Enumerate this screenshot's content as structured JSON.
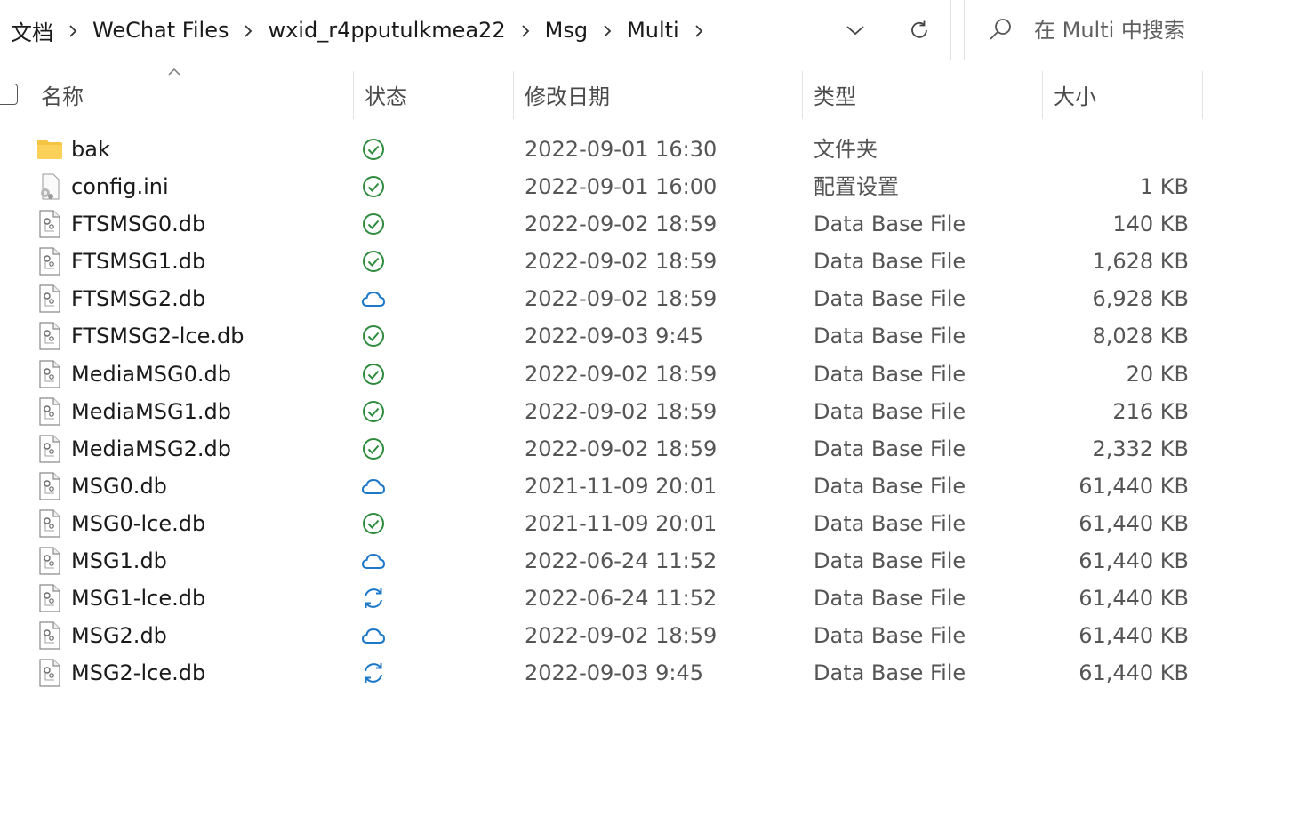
{
  "address": {
    "crumbs": [
      "文档",
      "WeChat Files",
      "wxid_r4pputulkmea22",
      "Msg",
      "Multi"
    ]
  },
  "search": {
    "placeholder": "在 Multi 中搜索"
  },
  "columns": {
    "name": "名称",
    "status": "状态",
    "modified": "修改日期",
    "type": "类型",
    "size": "大小"
  },
  "icons": {
    "folder": "folder-icon",
    "settings_file": "config-file-icon",
    "db_file": "db-file-icon",
    "synced": "green-check-icon",
    "cloud": "cloud-icon",
    "syncing": "sync-icon"
  },
  "colors": {
    "synced": "#2e8b3d",
    "cloud": "#1e78c8",
    "folder": "#f6c443"
  },
  "files": [
    {
      "name": "bak",
      "icon": "folder",
      "status": "synced",
      "date": "2022-09-01 16:30",
      "type": "文件夹",
      "size": ""
    },
    {
      "name": "config.ini",
      "icon": "settings",
      "status": "synced",
      "date": "2022-09-01 16:00",
      "type": "配置设置",
      "size": "1 KB"
    },
    {
      "name": "FTSMSG0.db",
      "icon": "db",
      "status": "synced",
      "date": "2022-09-02 18:59",
      "type": "Data Base File",
      "size": "140 KB"
    },
    {
      "name": "FTSMSG1.db",
      "icon": "db",
      "status": "synced",
      "date": "2022-09-02 18:59",
      "type": "Data Base File",
      "size": "1,628 KB"
    },
    {
      "name": "FTSMSG2.db",
      "icon": "db",
      "status": "cloud",
      "date": "2022-09-02 18:59",
      "type": "Data Base File",
      "size": "6,928 KB"
    },
    {
      "name": "FTSMSG2-lce.db",
      "icon": "db",
      "status": "synced",
      "date": "2022-09-03 9:45",
      "type": "Data Base File",
      "size": "8,028 KB"
    },
    {
      "name": "MediaMSG0.db",
      "icon": "db",
      "status": "synced",
      "date": "2022-09-02 18:59",
      "type": "Data Base File",
      "size": "20 KB"
    },
    {
      "name": "MediaMSG1.db",
      "icon": "db",
      "status": "synced",
      "date": "2022-09-02 18:59",
      "type": "Data Base File",
      "size": "216 KB"
    },
    {
      "name": "MediaMSG2.db",
      "icon": "db",
      "status": "synced",
      "date": "2022-09-02 18:59",
      "type": "Data Base File",
      "size": "2,332 KB"
    },
    {
      "name": "MSG0.db",
      "icon": "db",
      "status": "cloud",
      "date": "2021-11-09 20:01",
      "type": "Data Base File",
      "size": "61,440 KB"
    },
    {
      "name": "MSG0-lce.db",
      "icon": "db",
      "status": "synced",
      "date": "2021-11-09 20:01",
      "type": "Data Base File",
      "size": "61,440 KB"
    },
    {
      "name": "MSG1.db",
      "icon": "db",
      "status": "cloud",
      "date": "2022-06-24 11:52",
      "type": "Data Base File",
      "size": "61,440 KB"
    },
    {
      "name": "MSG1-lce.db",
      "icon": "db",
      "status": "syncing",
      "date": "2022-06-24 11:52",
      "type": "Data Base File",
      "size": "61,440 KB"
    },
    {
      "name": "MSG2.db",
      "icon": "db",
      "status": "cloud",
      "date": "2022-09-02 18:59",
      "type": "Data Base File",
      "size": "61,440 KB"
    },
    {
      "name": "MSG2-lce.db",
      "icon": "db",
      "status": "syncing",
      "date": "2022-09-03 9:45",
      "type": "Data Base File",
      "size": "61,440 KB"
    }
  ]
}
